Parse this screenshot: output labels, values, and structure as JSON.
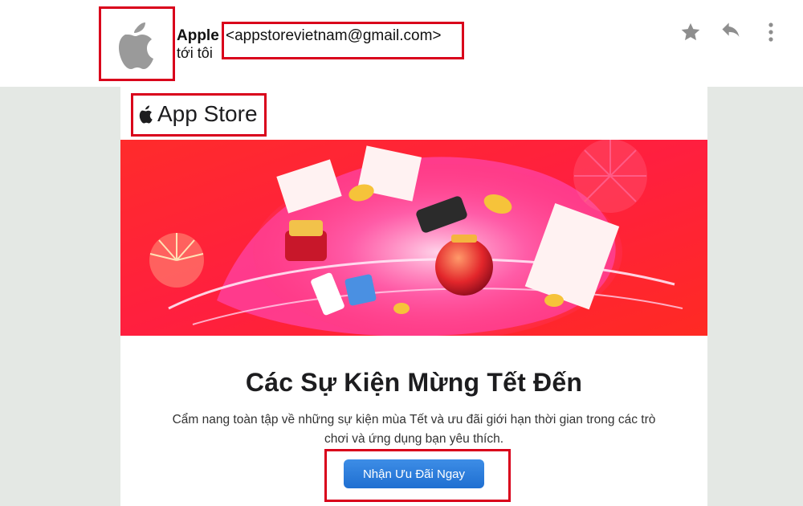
{
  "email": {
    "sender_name": "Apple",
    "sender_email": "<appstorevietnam@gmail.com>",
    "recipient": "tới tôi"
  },
  "actions": {
    "star_icon": "star-icon",
    "reply_icon": "reply-icon",
    "more_icon": "more-vertical-icon"
  },
  "content": {
    "brand": "App Store",
    "headline": "Các Sự Kiện Mừng Tết Đến",
    "description": "Cẩm nang toàn tập về những sự kiện mùa Tết và ưu đãi giới hạn thời gian trong các trò chơi và ứng dụng bạn yêu thích.",
    "cta_label": "Nhận Ưu Đãi Ngay"
  },
  "colors": {
    "highlight": "#d9001b",
    "button": "#2f7fdd",
    "banner": "#ff2a2a"
  }
}
